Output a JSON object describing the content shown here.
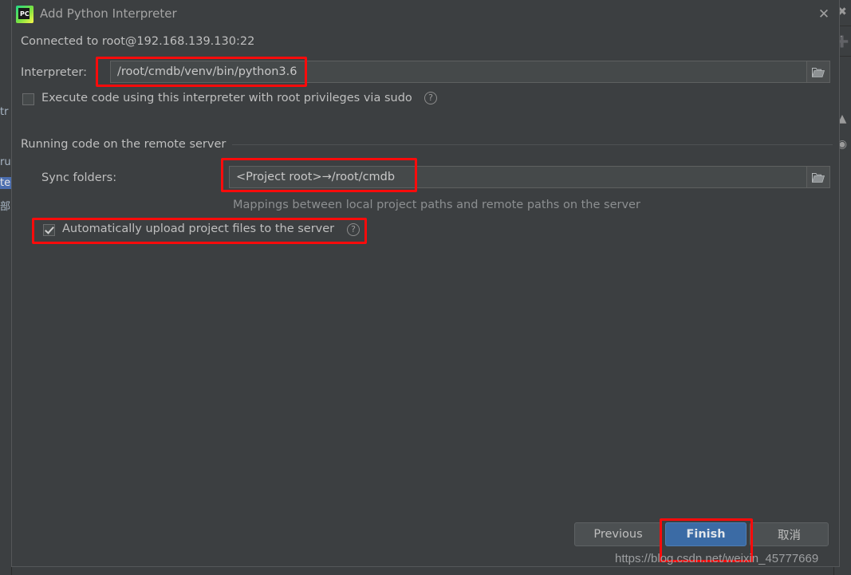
{
  "window": {
    "title": "Add Python Interpreter",
    "logo_icon": "pycharm-logo-icon",
    "close_icon": "close-icon"
  },
  "content": {
    "connected_status": "Connected to root@192.168.139.130:22",
    "interpreter": {
      "label": "Interpreter:",
      "value": "/root/cmdb/venv/bin/python3.6",
      "browse_icon": "folder-icon"
    },
    "sudo_option": {
      "label": "Execute code using this interpreter with root privileges via sudo",
      "checked": false,
      "help_icon": "help-circle-icon"
    },
    "group": {
      "title": "Running code on the remote server"
    },
    "sync_folders": {
      "label": "Sync folders:",
      "value": "<Project root>→/root/cmdb",
      "browse_icon": "folder-icon",
      "hint": "Mappings between local project paths and remote paths on the server"
    },
    "auto_upload": {
      "label": "Automatically upload project files to the server",
      "checked": true,
      "help_icon": "help-circle-icon"
    }
  },
  "footer": {
    "previous_label": "Previous",
    "finish_label": "Finish",
    "cancel_label": "取消"
  },
  "watermark": "https://blog.csdn.net/weixin_45777669",
  "background_ide": {
    "left_fragments": [
      "tr",
      "ru",
      "te",
      "部"
    ],
    "right_icons": [
      "close-x-icon",
      "plus-icon",
      "caret-up-icon",
      "circle-dot-icon"
    ]
  },
  "colors": {
    "dialog_bg": "#3c3f41",
    "field_bg": "#45494a",
    "primary_button": "#3b6ba5",
    "annotation_red": "#fb0b0b",
    "text": "#bfbfbf"
  }
}
